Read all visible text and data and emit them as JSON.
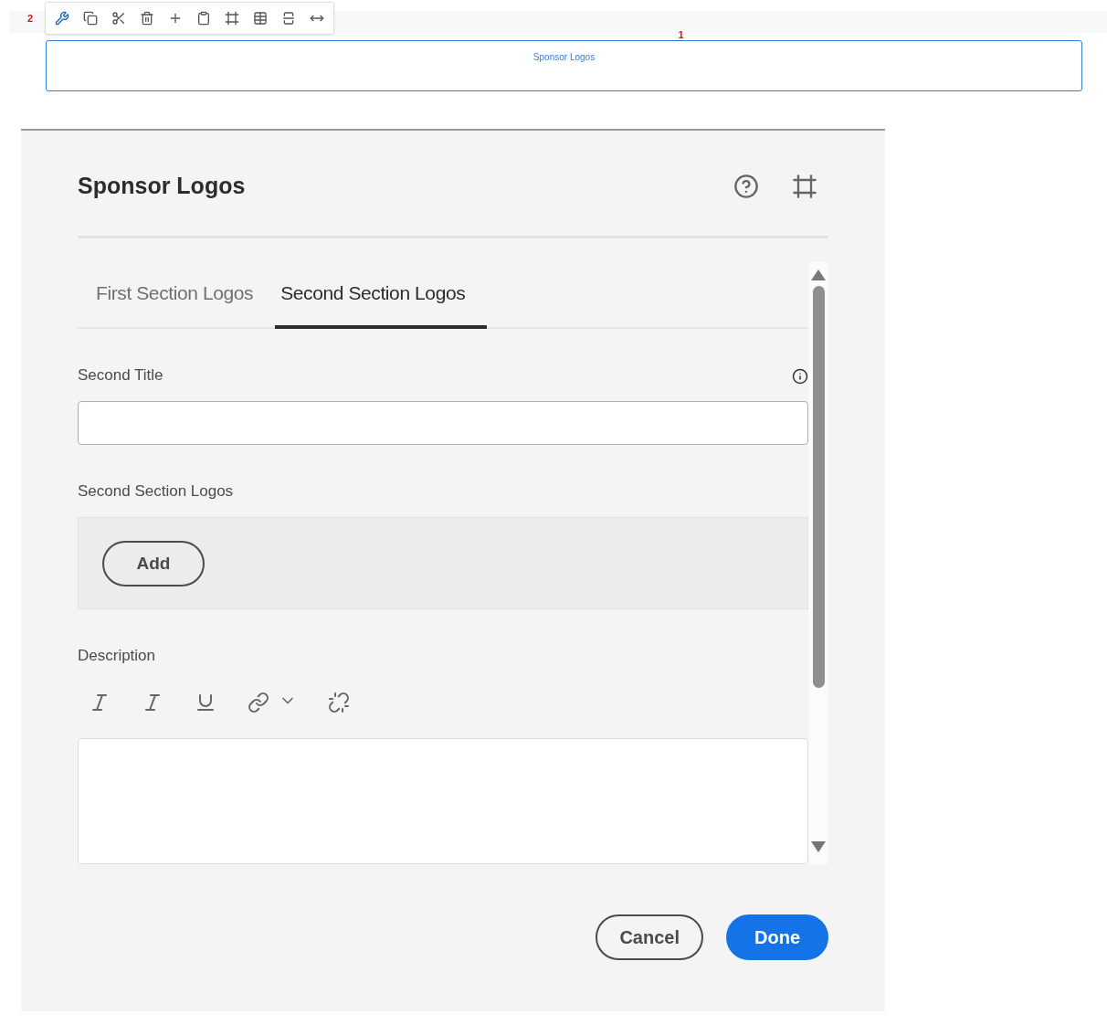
{
  "editor": {
    "toolbar_marker": "2",
    "component_marker": "1",
    "component_label": "Sponsor Logos"
  },
  "dialog": {
    "title": "Sponsor Logos",
    "tabs": [
      {
        "label": "First Section Logos",
        "selected": false
      },
      {
        "label": "Second Section Logos",
        "selected": true
      }
    ],
    "fields": [
      {
        "kind": "text",
        "label": "Second Title",
        "info": true
      },
      {
        "kind": "multifield",
        "label": "Second Section Logos",
        "add_button": "Add"
      },
      {
        "kind": "richtext",
        "label": "Description"
      }
    ],
    "buttons": [
      {
        "label": "Cancel",
        "kind": "secondary"
      },
      {
        "label": "Done",
        "kind": "primary"
      }
    ]
  }
}
